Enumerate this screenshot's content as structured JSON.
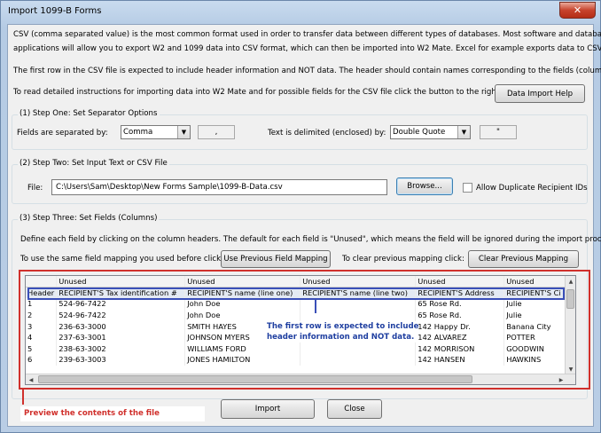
{
  "window": {
    "title": "Import 1099-B Forms",
    "close_glyph": "✕"
  },
  "intro": {
    "line1": "CSV (comma separated value) is the most common format used in order to transfer data between different types of databases.  Most software and database",
    "line2": "applications will allow you to export W2 and 1099 data into CSV format, which can then be imported into W2 Mate. Excel for example exports data to CSV .",
    "line3": "The first row in the CSV file is expected to include header information and NOT data. The header should contain names corresponding to the fields (columns) .",
    "line4": "To read detailed instructions for importing data into W2 Mate and for possible fields for the CSV file click the button to the right :",
    "help_button": "Data Import Help"
  },
  "step1": {
    "label": "(1)  Step One: Set Separator Options",
    "separated_label": "Fields are separated by:",
    "separated_value": "Comma",
    "separated_char": ",",
    "delimited_label": "Text is delimited (enclosed) by:",
    "delimited_value": "Double Quote",
    "delimited_char": "\""
  },
  "step2": {
    "label": "(2)  Step Two: Set Input Text or CSV File",
    "file_label": "File:",
    "file_value": "C:\\Users\\Sam\\Desktop\\New Forms Sample\\1099-B-Data.csv",
    "browse_button": "Browse...",
    "allow_duplicates_label": "Allow Duplicate Recipient IDs",
    "allow_duplicates_checked": false
  },
  "step3": {
    "label": "(3)  Step Three: Set Fields (Columns)",
    "description": "Define each field by clicking on the column headers. The default for each field is \"Unused\", which means the field will be ignored during the import process.",
    "previous_label": "To use the same field mapping you used before click:",
    "previous_button": "Use Previous Field Mapping",
    "clear_label": "To clear previous mapping click:",
    "clear_button": "Clear Previous Mapping"
  },
  "grid": {
    "mapping_row": [
      "",
      "Unused",
      "Unused",
      "Unused",
      "Unused",
      "Unused"
    ],
    "header_row": [
      "Header",
      "RECIPIENT'S Tax identification #",
      "RECIPIENT'S name (line one)",
      "RECIPIENT'S name (line two)",
      "RECIPIENT'S Address",
      "RECIPIENT'S Ci"
    ],
    "rows": [
      [
        "1",
        "524-96-7422",
        "John Doe",
        "",
        "65 Rose Rd.",
        "Julie"
      ],
      [
        "2",
        "524-96-7422",
        "John Doe",
        "",
        "65 Rose Rd.",
        "Julie"
      ],
      [
        "3",
        "236-63-3000",
        "SMITH HAYES",
        "",
        "142 Happy Dr.",
        "Banana City"
      ],
      [
        "4",
        "237-63-3001",
        "JOHNSON MYERS",
        "",
        "142 ALVAREZ",
        "POTTER"
      ],
      [
        "5",
        "238-63-3002",
        "WILLIAMS FORD",
        "",
        "142 MORRISON",
        "GOODWIN"
      ],
      [
        "6",
        "239-63-3003",
        "JONES HAMILTON",
        "",
        "142 HANSEN",
        "HAWKINS"
      ]
    ]
  },
  "callouts": {
    "header_note_line1": "The first row is expected to include",
    "header_note_line2": "header information and NOT data.",
    "preview_note": "Preview the contents of the file",
    "color": "#d0302c",
    "note_color": "#1f3fa0"
  },
  "footer": {
    "import_button": "Import",
    "close_button": "Close"
  }
}
